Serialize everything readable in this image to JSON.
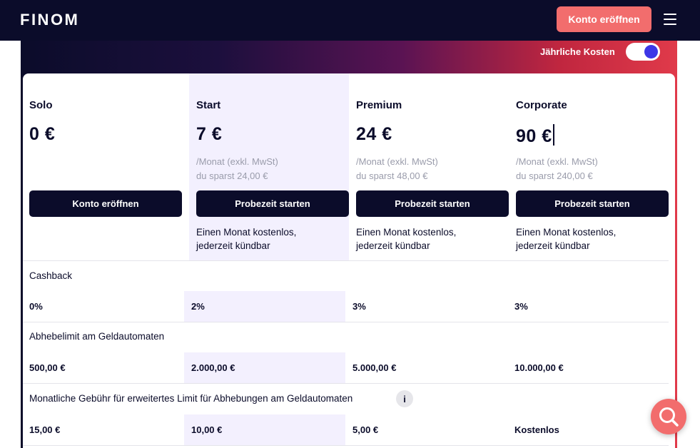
{
  "nav": {
    "logo": "FINOM",
    "cta_label": "Konto eröffnen",
    "menu_icon": "hamburger-menu-icon"
  },
  "billing": {
    "toggle_label": "Jährliche Kosten",
    "annual_enabled": true
  },
  "plans": [
    {
      "name": "Solo",
      "price": "0 €",
      "period": "",
      "savings": "",
      "button": "Konto eröffnen",
      "note_line1": "",
      "note_line2": ""
    },
    {
      "name": "Start",
      "price": "7 €",
      "period": "/Monat (exkl. MwSt)",
      "savings": "du sparst 24,00 €",
      "button": "Probezeit starten",
      "note_line1": "Einen Monat kostenlos,",
      "note_line2": "jederzeit kündbar"
    },
    {
      "name": "Premium",
      "price": "24 €",
      "period": "/Monat (exkl. MwSt)",
      "savings": "du sparst 48,00 €",
      "button": "Probezeit starten",
      "note_line1": "Einen Monat kostenlos,",
      "note_line2": "jederzeit kündbar"
    },
    {
      "name": "Corporate",
      "price": "90 €",
      "period": "/Monat (exkl. MwSt)",
      "savings": "du sparst 240,00 €",
      "button": "Probezeit starten",
      "note_line1": "Einen Monat kostenlos,",
      "note_line2": "jederzeit kündbar"
    }
  ],
  "features": [
    {
      "label": "Cashback",
      "values": [
        "0%",
        "2%",
        "3%",
        "3%"
      ]
    },
    {
      "label": "Abhebelimit am Geldautomaten",
      "values": [
        "500,00 €",
        "2.000,00 €",
        "5.000,00 €",
        "10.000,00 €"
      ]
    },
    {
      "label": "Monatliche Gebühr für erweitertes Limit für Abhebungen am Geldautomaten",
      "info_icon": "i",
      "values": [
        "15,00 €",
        "10,00 €",
        "5,00 €",
        "Kostenlos"
      ]
    }
  ],
  "colors": {
    "navy": "#0b0c2a",
    "accent_coral": "#f26d6d",
    "toggle_blue": "#3d36e6",
    "highlight": "#f3f0fe"
  },
  "help_icon": "search-chat-icon"
}
